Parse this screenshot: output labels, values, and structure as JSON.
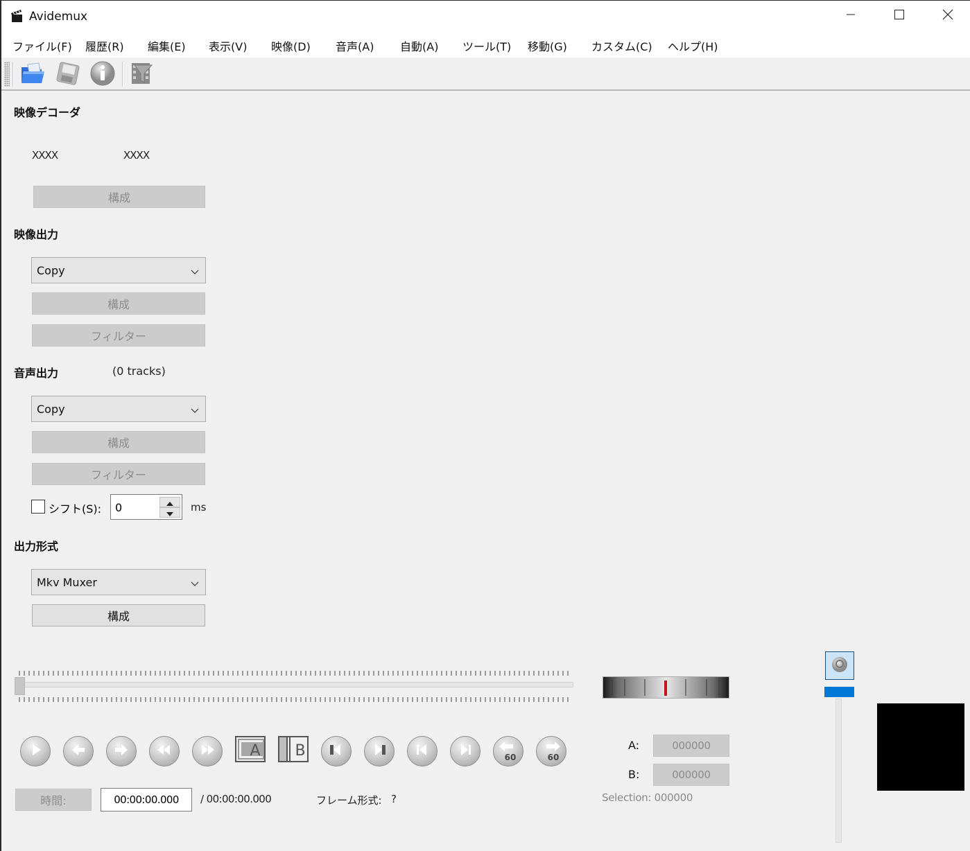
{
  "window": {
    "title": "Avidemux",
    "icon": "clapperboard-icon",
    "controls": {
      "minimize": "minimize-icon",
      "maximize": "maximize-icon",
      "close": "close-icon"
    }
  },
  "menubar": {
    "items": [
      {
        "label": "ファイル(F)"
      },
      {
        "label": "履歴(R)"
      },
      {
        "label": "編集(E)"
      },
      {
        "label": "表示(V)"
      },
      {
        "label": "映像(D)"
      },
      {
        "label": "音声(A)"
      },
      {
        "label": "自動(A)"
      },
      {
        "label": "ツール(T)"
      },
      {
        "label": "移動(G)"
      },
      {
        "label": "カスタム(C)"
      },
      {
        "label": "ヘルプ(H)"
      }
    ]
  },
  "toolbar": {
    "buttons": [
      {
        "name": "open",
        "icon": "open-folder-icon"
      },
      {
        "name": "save",
        "icon": "save-disk-icon"
      },
      {
        "name": "properties",
        "icon": "info-icon"
      },
      {
        "name": "filters",
        "icon": "film-filter-icon"
      }
    ]
  },
  "video_decoder": {
    "title": "映像デコーダ",
    "value1": "XXXX",
    "value2": "XXXX",
    "configure_label": "構成"
  },
  "video_output": {
    "title": "映像出力",
    "codec": "Copy",
    "configure_label": "構成",
    "filters_label": "フィルター"
  },
  "audio_output": {
    "title": "音声出力",
    "tracks": "(0 tracks)",
    "codec": "Copy",
    "configure_label": "構成",
    "filters_label": "フィルター",
    "shift_label": "シフト(S):",
    "shift_checked": false,
    "shift_value": "0",
    "shift_unit": "ms"
  },
  "output_format": {
    "title": "出力形式",
    "muxer": "Mkv Muxer",
    "configure_label": "構成"
  },
  "timeline": {
    "position_fraction": 0.0
  },
  "transport": {
    "buttons": [
      {
        "name": "play",
        "icon": "play-icon"
      },
      {
        "name": "previous-frame",
        "icon": "arrow-left-icon"
      },
      {
        "name": "next-frame",
        "icon": "arrow-right-icon"
      },
      {
        "name": "previous-keyframe",
        "icon": "rewind-icon"
      },
      {
        "name": "next-keyframe",
        "icon": "fast-forward-icon"
      },
      {
        "name": "set-marker-a",
        "icon": "marker-a-icon",
        "label": "A"
      },
      {
        "name": "set-marker-b",
        "icon": "marker-b-icon",
        "label": "B"
      },
      {
        "name": "previous-cut-point",
        "icon": "previous-cut-icon"
      },
      {
        "name": "next-cut-point",
        "icon": "next-cut-icon"
      },
      {
        "name": "first-frame",
        "icon": "skip-to-start-icon"
      },
      {
        "name": "last-frame",
        "icon": "skip-to-end-icon"
      },
      {
        "name": "back-60s",
        "icon": "back-60-icon",
        "badge": "60"
      },
      {
        "name": "forward-60s",
        "icon": "forward-60-icon",
        "badge": "60"
      }
    ]
  },
  "time": {
    "button_label": "時間:",
    "current": "00:00:00.000",
    "total": "/ 00:00:00.000",
    "frame_type_label": "フレーム形式:",
    "frame_type_value": "?"
  },
  "markers": {
    "a_label": "A:",
    "a_value": "000000",
    "b_label": "B:",
    "b_value": "000000",
    "selection": "Selection: 000000"
  },
  "volume": {
    "icon": "speaker-icon",
    "level_fraction": 1.0
  },
  "colors": {
    "accent": "#0078d7",
    "jog_marker": "#c8151b",
    "volume_button_bg": "#cce4f7"
  }
}
